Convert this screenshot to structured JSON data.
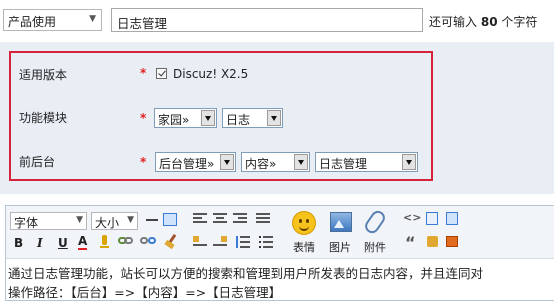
{
  "header": {
    "category_select_value": "产品使用",
    "title_input_value": "日志管理",
    "remaining_prefix": "还可输入",
    "remaining_count": "80",
    "remaining_suffix": "个字符"
  },
  "settings": {
    "version": {
      "label": "适用版本",
      "required_mark": "*",
      "checkbox_checked": true,
      "option_label": "Discuz! X2.5"
    },
    "module": {
      "label": "功能模块",
      "required_mark": "*",
      "select1": "家园»",
      "select2": "日志"
    },
    "backend": {
      "label": "前后台",
      "required_mark": "*",
      "select1": "后台管理»",
      "select2": "内容»",
      "select3": "日志管理"
    }
  },
  "toolbar": {
    "font_select": "字体",
    "size_select": "大小",
    "bold": "B",
    "italic": "I",
    "underline": "U",
    "font_color": "A",
    "emoticon_label": "表情",
    "image_label": "图片",
    "attachment_label": "附件",
    "quote_glyph": "“"
  },
  "colors": {
    "panel_bg": "#e9eef5",
    "highlight_border": "#d6223b",
    "required": "#e02020"
  },
  "editor": {
    "line1": "通过日志管理功能，站长可以方便的搜索和管理到用户所发表的日志内容，并且连同对",
    "line2": "操作路径：【后台】=>【内容】=>【日志管理】"
  }
}
